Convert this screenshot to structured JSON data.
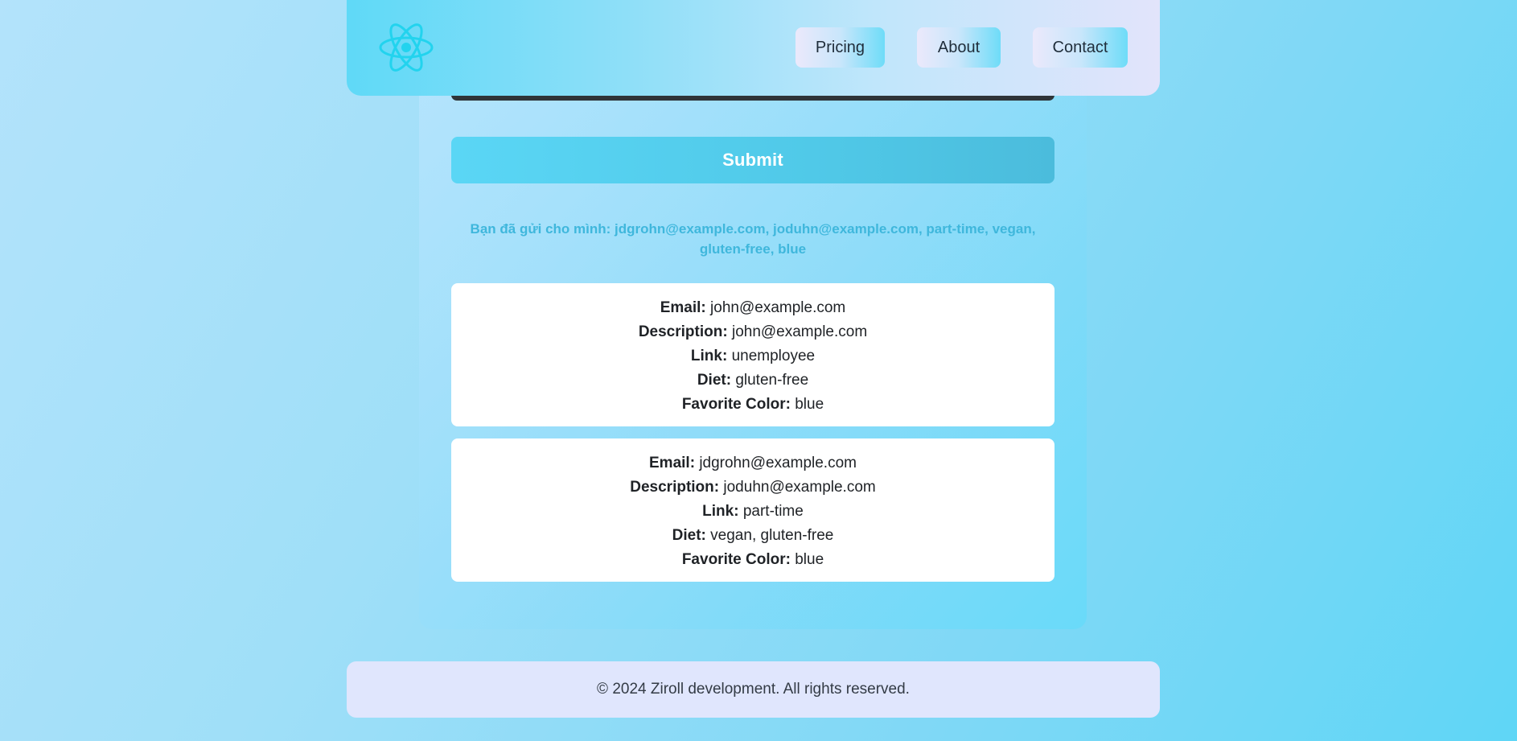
{
  "colors": {
    "accent": "#5ad6f5",
    "logo": "#22d3ee",
    "footer_bg": "#e0e6fd",
    "message": "#3fb7dc"
  },
  "header": {
    "logo_icon": "react-atom-icon",
    "nav": [
      {
        "label": "Pricing"
      },
      {
        "label": "About"
      },
      {
        "label": "Contact"
      }
    ]
  },
  "form": {
    "submit_label": "Submit",
    "sent_message": "Bạn đã gửi cho mình: jdgrohn@example.com, joduhn@example.com, part-time, vegan, gluten-free, blue"
  },
  "entries": [
    {
      "email_label": "Email:",
      "email": "john@example.com",
      "description_label": "Description:",
      "description": "john@example.com",
      "link_label": "Link:",
      "link": "unemployee",
      "diet_label": "Diet:",
      "diet": "gluten-free",
      "color_label": "Favorite Color:",
      "color": "blue"
    },
    {
      "email_label": "Email:",
      "email": "jdgrohn@example.com",
      "description_label": "Description:",
      "description": "joduhn@example.com",
      "link_label": "Link:",
      "link": "part-time",
      "diet_label": "Diet:",
      "diet": "vegan, gluten-free",
      "color_label": "Favorite Color:",
      "color": "blue"
    }
  ],
  "footer": {
    "text": "© 2024 Ziroll development. All rights reserved."
  }
}
